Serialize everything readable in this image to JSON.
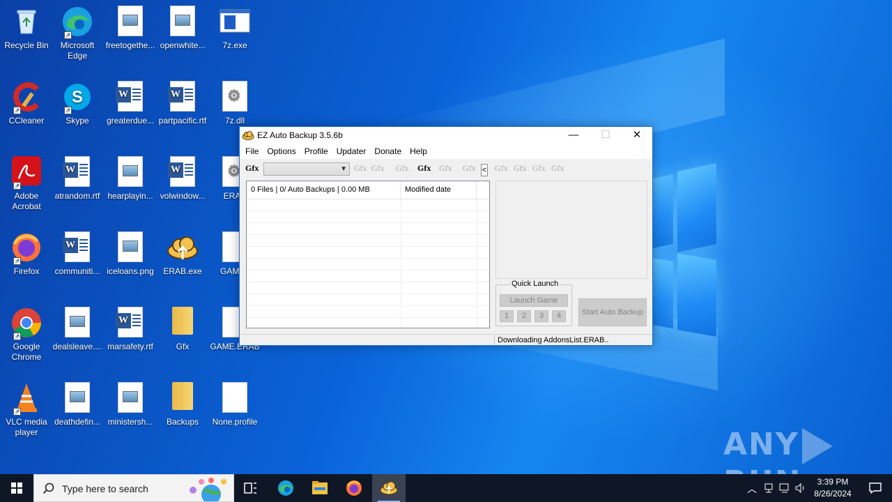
{
  "desktop": {
    "icons": [
      {
        "label": "Recycle Bin"
      },
      {
        "label": "Microsoft Edge"
      },
      {
        "label": "freetogethe..."
      },
      {
        "label": "openwhite..."
      },
      {
        "label": "7z.exe"
      },
      {
        "label": "CCleaner"
      },
      {
        "label": "Skype"
      },
      {
        "label": "greaterdue..."
      },
      {
        "label": "partpacific.rtf"
      },
      {
        "label": "7z.dll"
      },
      {
        "label": "Adobe Acrobat"
      },
      {
        "label": "atrandom.rtf"
      },
      {
        "label": "hearplayin..."
      },
      {
        "label": "volwindow..."
      },
      {
        "label": "ERAB"
      },
      {
        "label": "Firefox"
      },
      {
        "label": "communiti..."
      },
      {
        "label": "iceloans.png"
      },
      {
        "label": "ERAB.exe"
      },
      {
        "label": "GAMEL"
      },
      {
        "label": "Google Chrome"
      },
      {
        "label": "dealsleave...."
      },
      {
        "label": "marsafety.rtf"
      },
      {
        "label": "Gfx"
      },
      {
        "label": "GAME.ERAB"
      },
      {
        "label": "VLC media player"
      },
      {
        "label": "deathdefin..."
      },
      {
        "label": "ministersh..."
      },
      {
        "label": "Backups"
      },
      {
        "label": "None.profile"
      }
    ],
    "watermark": "ANY RUN"
  },
  "window": {
    "title": "EZ Auto Backup 3.5.6b",
    "controls": {
      "minimize": "—",
      "maximize": "☐",
      "close": "✕"
    },
    "menu": [
      "File",
      "Options",
      "Profile",
      "Updater",
      "Donate",
      "Help"
    ],
    "toolbar": {
      "label": "Gfx",
      "combo_value": "",
      "gfx_buttons": [
        "Gfx",
        "Gfx",
        "Gfx",
        "Gfx",
        "Gfx",
        "Gfx",
        "Gfx",
        "Gfx",
        "Gfx",
        "Gfx"
      ],
      "collapse_label": "<"
    },
    "list": {
      "columns": [
        "0 Files | 0/ Auto Backups | 0.00 MB",
        "Modified date"
      ],
      "rows": []
    },
    "quick_launch": {
      "title": "Quick Launch",
      "launch_label": "Launch Game",
      "slots": [
        "1",
        "2",
        "3",
        "4"
      ]
    },
    "start_auto_backup_label": "Start Auto Backup",
    "status": {
      "left": "",
      "right": "Downloading AddonsList.ERAB.."
    }
  },
  "taskbar": {
    "search_placeholder": "Type here to search",
    "pinned": [
      "task-view-icon",
      "edge-icon",
      "file-explorer-icon",
      "firefox-icon",
      "ez-auto-backup-icon"
    ],
    "clock": {
      "time": "3:39 PM",
      "date": "8/26/2024"
    }
  }
}
